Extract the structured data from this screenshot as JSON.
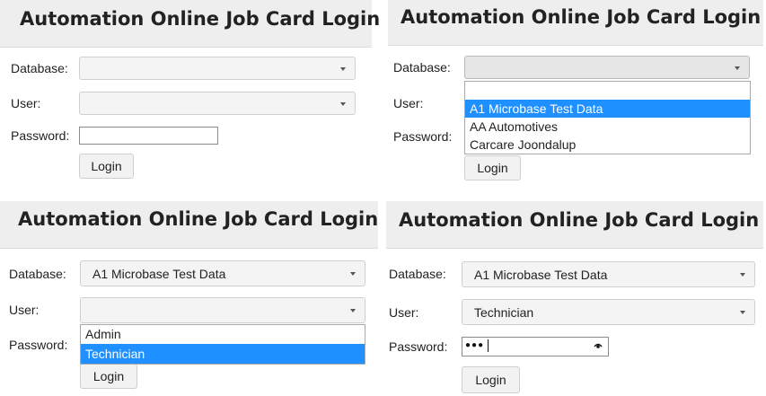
{
  "panels": [
    {
      "title": "Automation Online Job Card Login",
      "database_label": "Database:",
      "user_label": "User:",
      "password_label": "Password:",
      "database_value": "",
      "user_value": "",
      "login_label": "Login"
    },
    {
      "title": "Automation Online Job Card Login",
      "database_label": "Database:",
      "user_label": "User:",
      "password_label": "Password:",
      "database_value": "",
      "login_label": "Login",
      "database_options": [
        "",
        "A1 Microbase Test Data",
        "AA Automotives",
        "Carcare Joondalup"
      ],
      "database_selected_option": "A1 Microbase Test Data"
    },
    {
      "title": "Automation Online Job Card Login",
      "database_label": "Database:",
      "user_label": "User:",
      "password_label": "Password:",
      "database_value": "A1 Microbase Test Data",
      "user_value": "",
      "login_label": "Login",
      "user_options": [
        "Admin",
        "Technician"
      ],
      "user_selected_option": "Technician"
    },
    {
      "title": "Automation Online Job Card Login",
      "database_label": "Database:",
      "user_label": "User:",
      "password_label": "Password:",
      "database_value": "A1 Microbase Test Data",
      "user_value": "Technician",
      "password_masked": "●●●",
      "login_label": "Login"
    }
  ],
  "colors": {
    "header_bg": "#eeeeee",
    "selected_option_bg": "#1e90ff"
  }
}
